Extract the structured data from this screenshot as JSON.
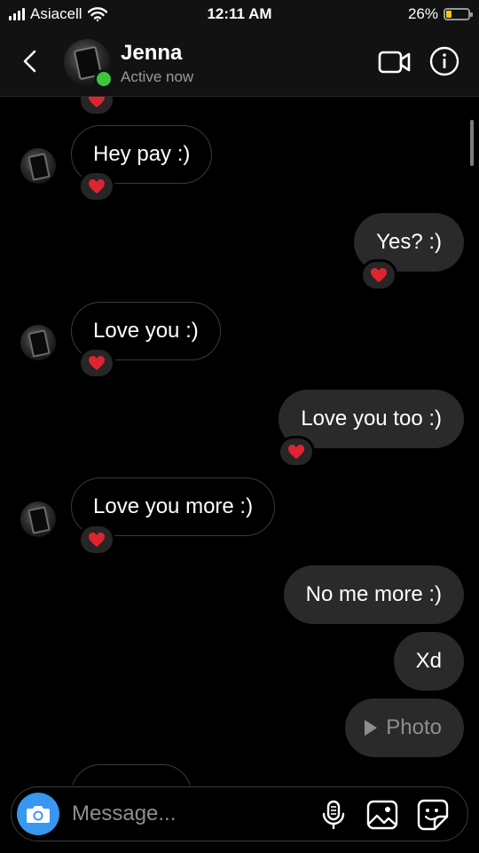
{
  "status_bar": {
    "carrier": "Asiacell",
    "time": "12:11 AM",
    "battery_percent": "26%",
    "battery_level": 0.26,
    "battery_color": "#f5c518"
  },
  "header": {
    "name": "Jenna",
    "status": "Active now",
    "online_color": "#3ec43e"
  },
  "messages": [
    {
      "direction": "incoming",
      "text": "Hey pay :)",
      "reaction": "heart"
    },
    {
      "direction": "outgoing",
      "text": "Yes? :)",
      "reaction": "heart"
    },
    {
      "direction": "incoming",
      "text": "Love you :)",
      "reaction": "heart"
    },
    {
      "direction": "outgoing",
      "text": "Love you too :)",
      "reaction": "heart"
    },
    {
      "direction": "incoming",
      "text": "Love you more :)",
      "reaction": "heart"
    },
    {
      "direction": "outgoing",
      "text": "No me more :)"
    },
    {
      "direction": "outgoing",
      "text": "Xd"
    },
    {
      "direction": "outgoing",
      "type": "photo",
      "text": "Photo",
      "icon": "play-icon"
    }
  ],
  "composer": {
    "placeholder": "Message...",
    "camera_color": "#3897f0"
  },
  "colors": {
    "background": "#000000",
    "outgoing_bubble": "#2a2a2a",
    "incoming_border": "#3a3a3a",
    "heart": "#e0242f"
  }
}
